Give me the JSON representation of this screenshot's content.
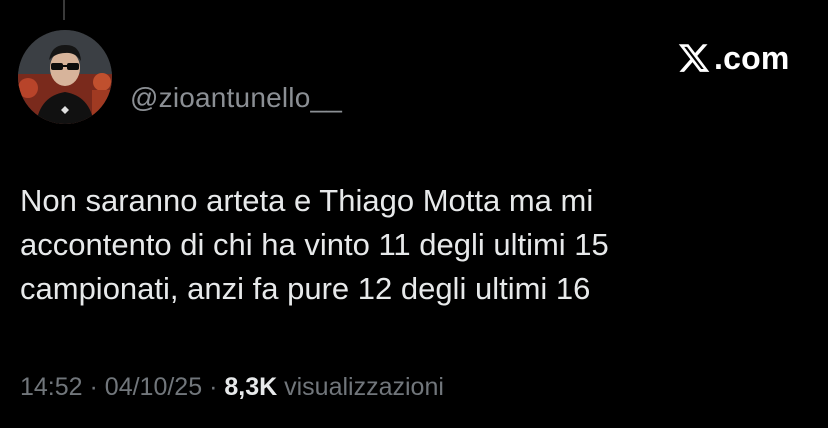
{
  "tweet": {
    "handle": "@zioantunello__",
    "brand": ".com",
    "text_lines": [
      "Non saranno arteta e Thiago Motta ma mi",
      "accontento di chi ha vinto 11 degli ultimi 15",
      "campionati, anzi fa pure 12 degli ultimi 16"
    ],
    "time": "14:52",
    "separator": "·",
    "date": "04/10/25",
    "views_count": "8,3K",
    "views_label": "visualizzazioni"
  },
  "icons": {
    "brand_logo": "x-logo-icon",
    "avatar": "profile-photo"
  },
  "colors": {
    "background": "#000000",
    "primary_text": "#e7e9ea",
    "secondary_text": "#71767b",
    "handle_text": "#8b8f94"
  }
}
